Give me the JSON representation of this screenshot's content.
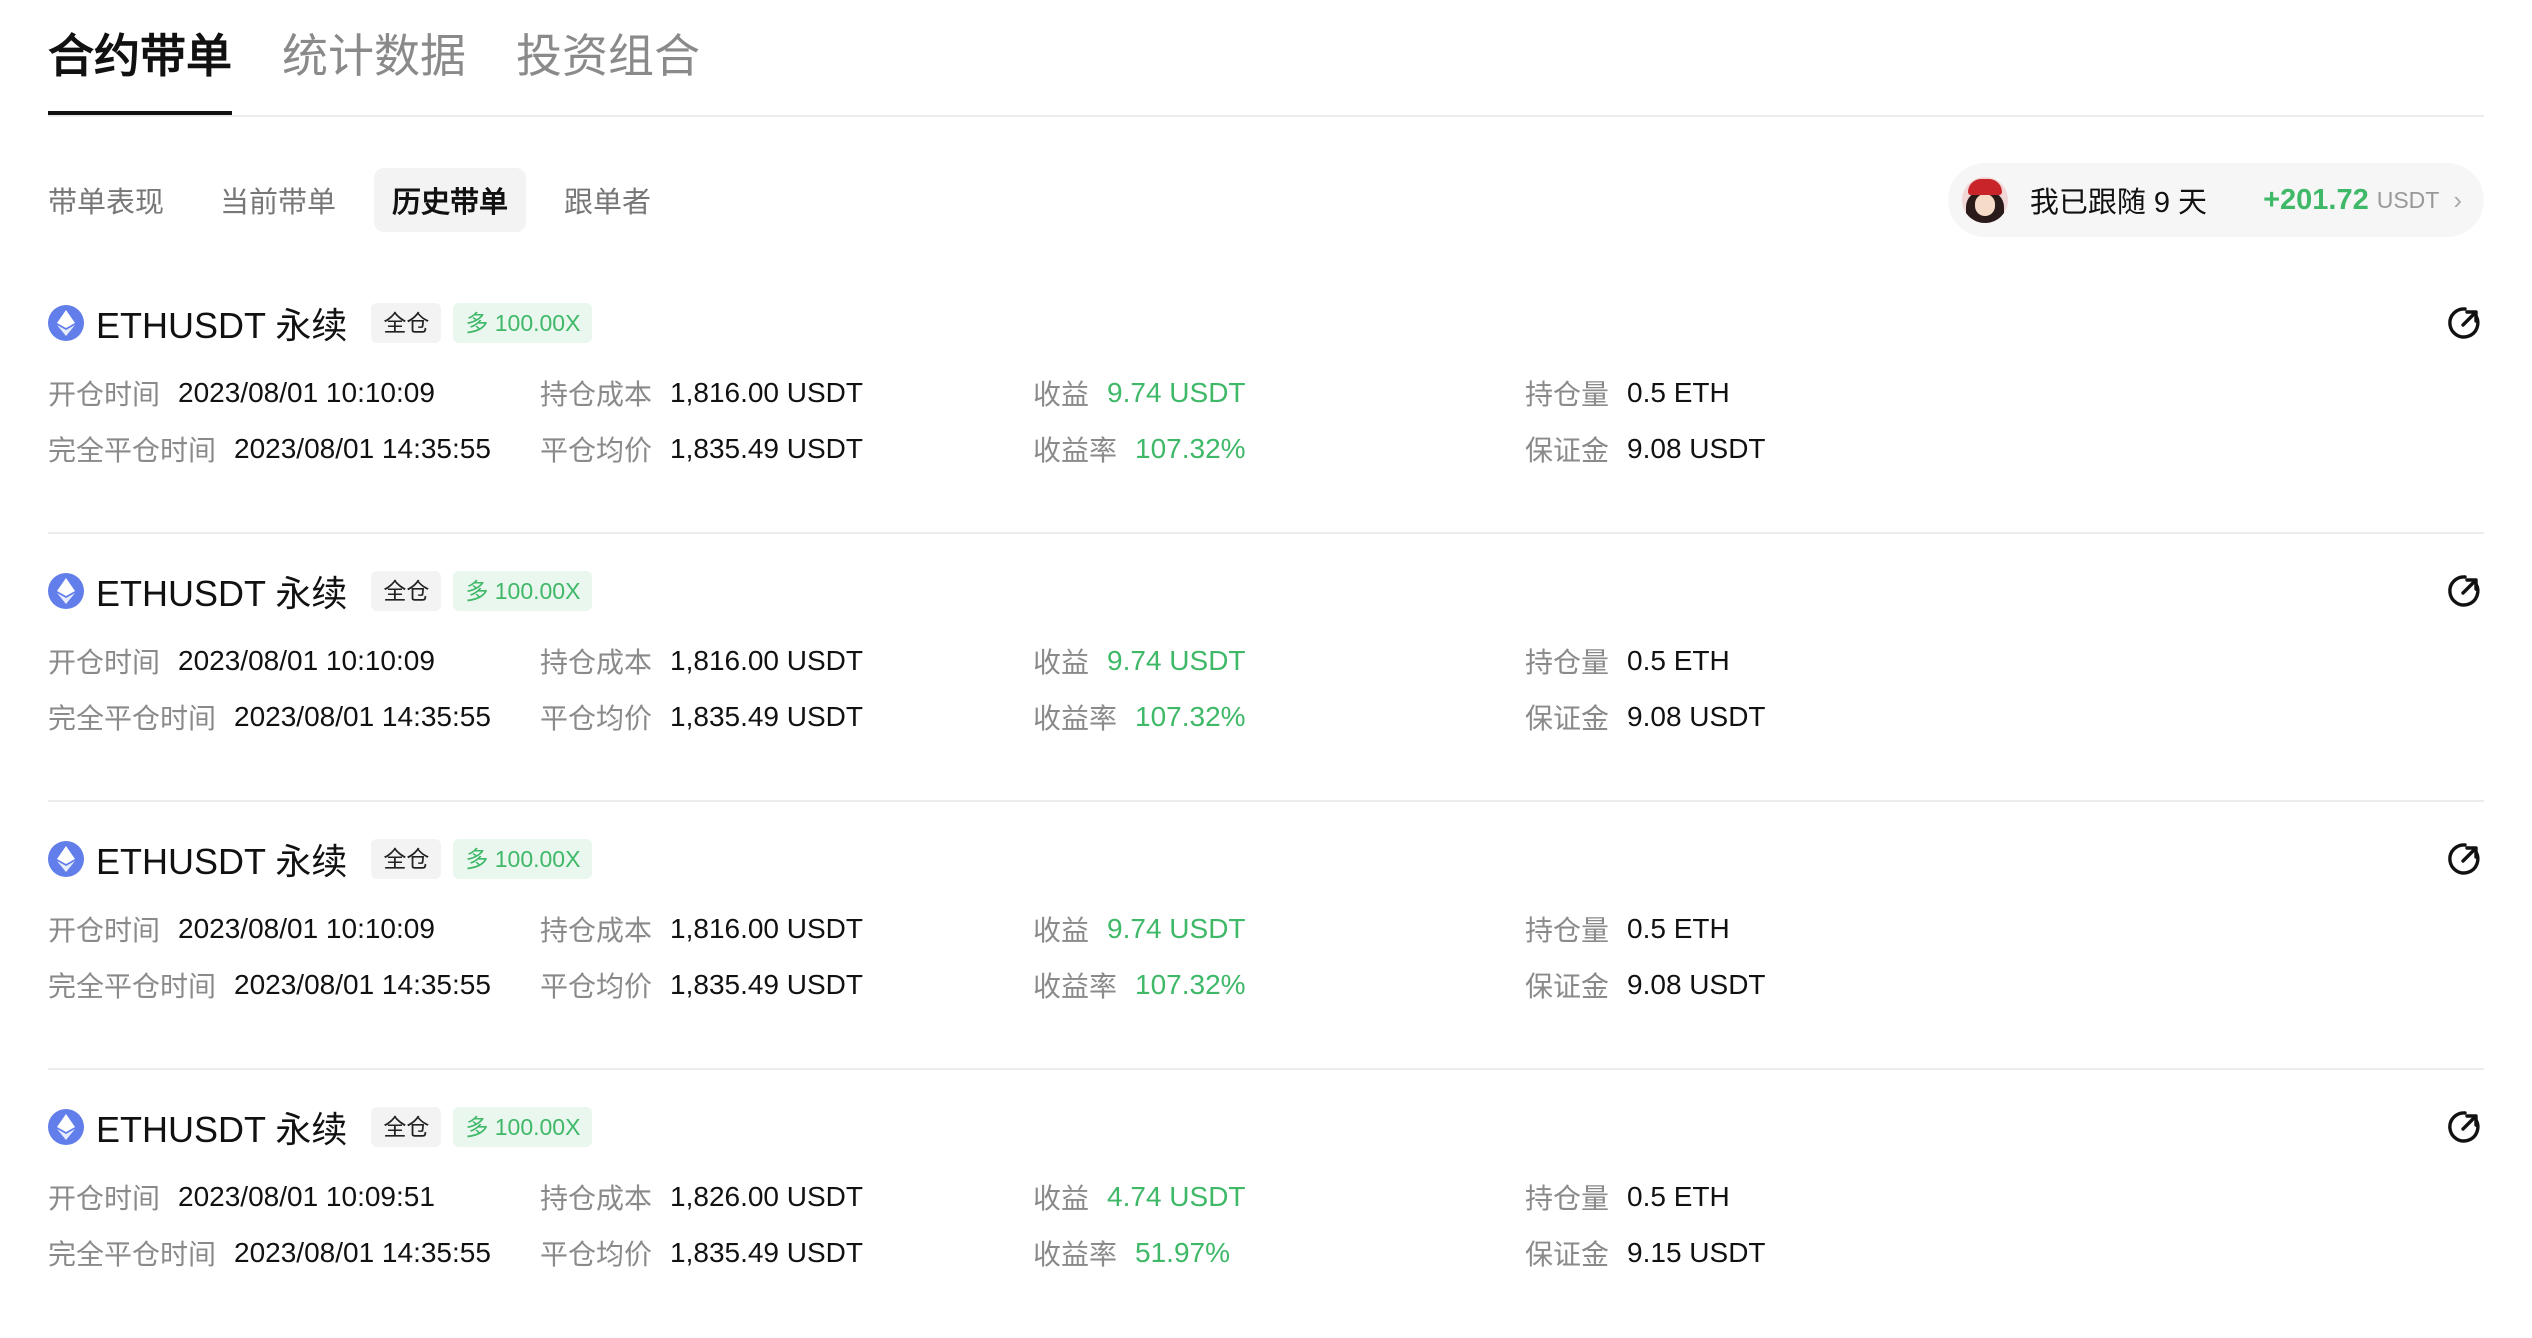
{
  "top_tabs": [
    {
      "label": "合约带单",
      "active": true
    },
    {
      "label": "统计数据",
      "active": false
    },
    {
      "label": "投资组合",
      "active": false
    }
  ],
  "sub_tabs": [
    {
      "label": "带单表现",
      "active": false
    },
    {
      "label": "当前带单",
      "active": false
    },
    {
      "label": "历史带单",
      "active": true
    },
    {
      "label": "跟单者",
      "active": false
    }
  ],
  "follow": {
    "text": "我已跟随 9 天",
    "amount": "+201.72",
    "unit": "USDT"
  },
  "labels": {
    "open_time": "开仓时间",
    "close_time": "完全平仓时间",
    "cost": "持仓成本",
    "avg_close": "平仓均价",
    "pnl": "收益",
    "roi": "收益率",
    "size": "持仓量",
    "margin": "保证金"
  },
  "colors": {
    "accent_green": "#3fb868",
    "eth_blue": "#627eea"
  },
  "orders": [
    {
      "symbol": "ETHUSDT 永续",
      "margin_mode": "全仓",
      "leverage": "多 100.00X",
      "open_time": "2023/08/01 10:10:09",
      "close_time": "2023/08/01 14:35:55",
      "cost": "1,816.00 USDT",
      "avg_close": "1,835.49 USDT",
      "pnl": "9.74 USDT",
      "roi": "107.32%",
      "size": "0.5 ETH",
      "margin": "9.08 USDT"
    },
    {
      "symbol": "ETHUSDT 永续",
      "margin_mode": "全仓",
      "leverage": "多 100.00X",
      "open_time": "2023/08/01 10:10:09",
      "close_time": "2023/08/01 14:35:55",
      "cost": "1,816.00 USDT",
      "avg_close": "1,835.49 USDT",
      "pnl": "9.74 USDT",
      "roi": "107.32%",
      "size": "0.5 ETH",
      "margin": "9.08 USDT"
    },
    {
      "symbol": "ETHUSDT 永续",
      "margin_mode": "全仓",
      "leverage": "多 100.00X",
      "open_time": "2023/08/01 10:10:09",
      "close_time": "2023/08/01 14:35:55",
      "cost": "1,816.00 USDT",
      "avg_close": "1,835.49 USDT",
      "pnl": "9.74 USDT",
      "roi": "107.32%",
      "size": "0.5 ETH",
      "margin": "9.08 USDT"
    },
    {
      "symbol": "ETHUSDT 永续",
      "margin_mode": "全仓",
      "leverage": "多 100.00X",
      "open_time": "2023/08/01 10:09:51",
      "close_time": "2023/08/01 14:35:55",
      "cost": "1,826.00 USDT",
      "avg_close": "1,835.49 USDT",
      "pnl": "4.74 USDT",
      "roi": "51.97%",
      "size": "0.5 ETH",
      "margin": "9.15 USDT"
    }
  ]
}
